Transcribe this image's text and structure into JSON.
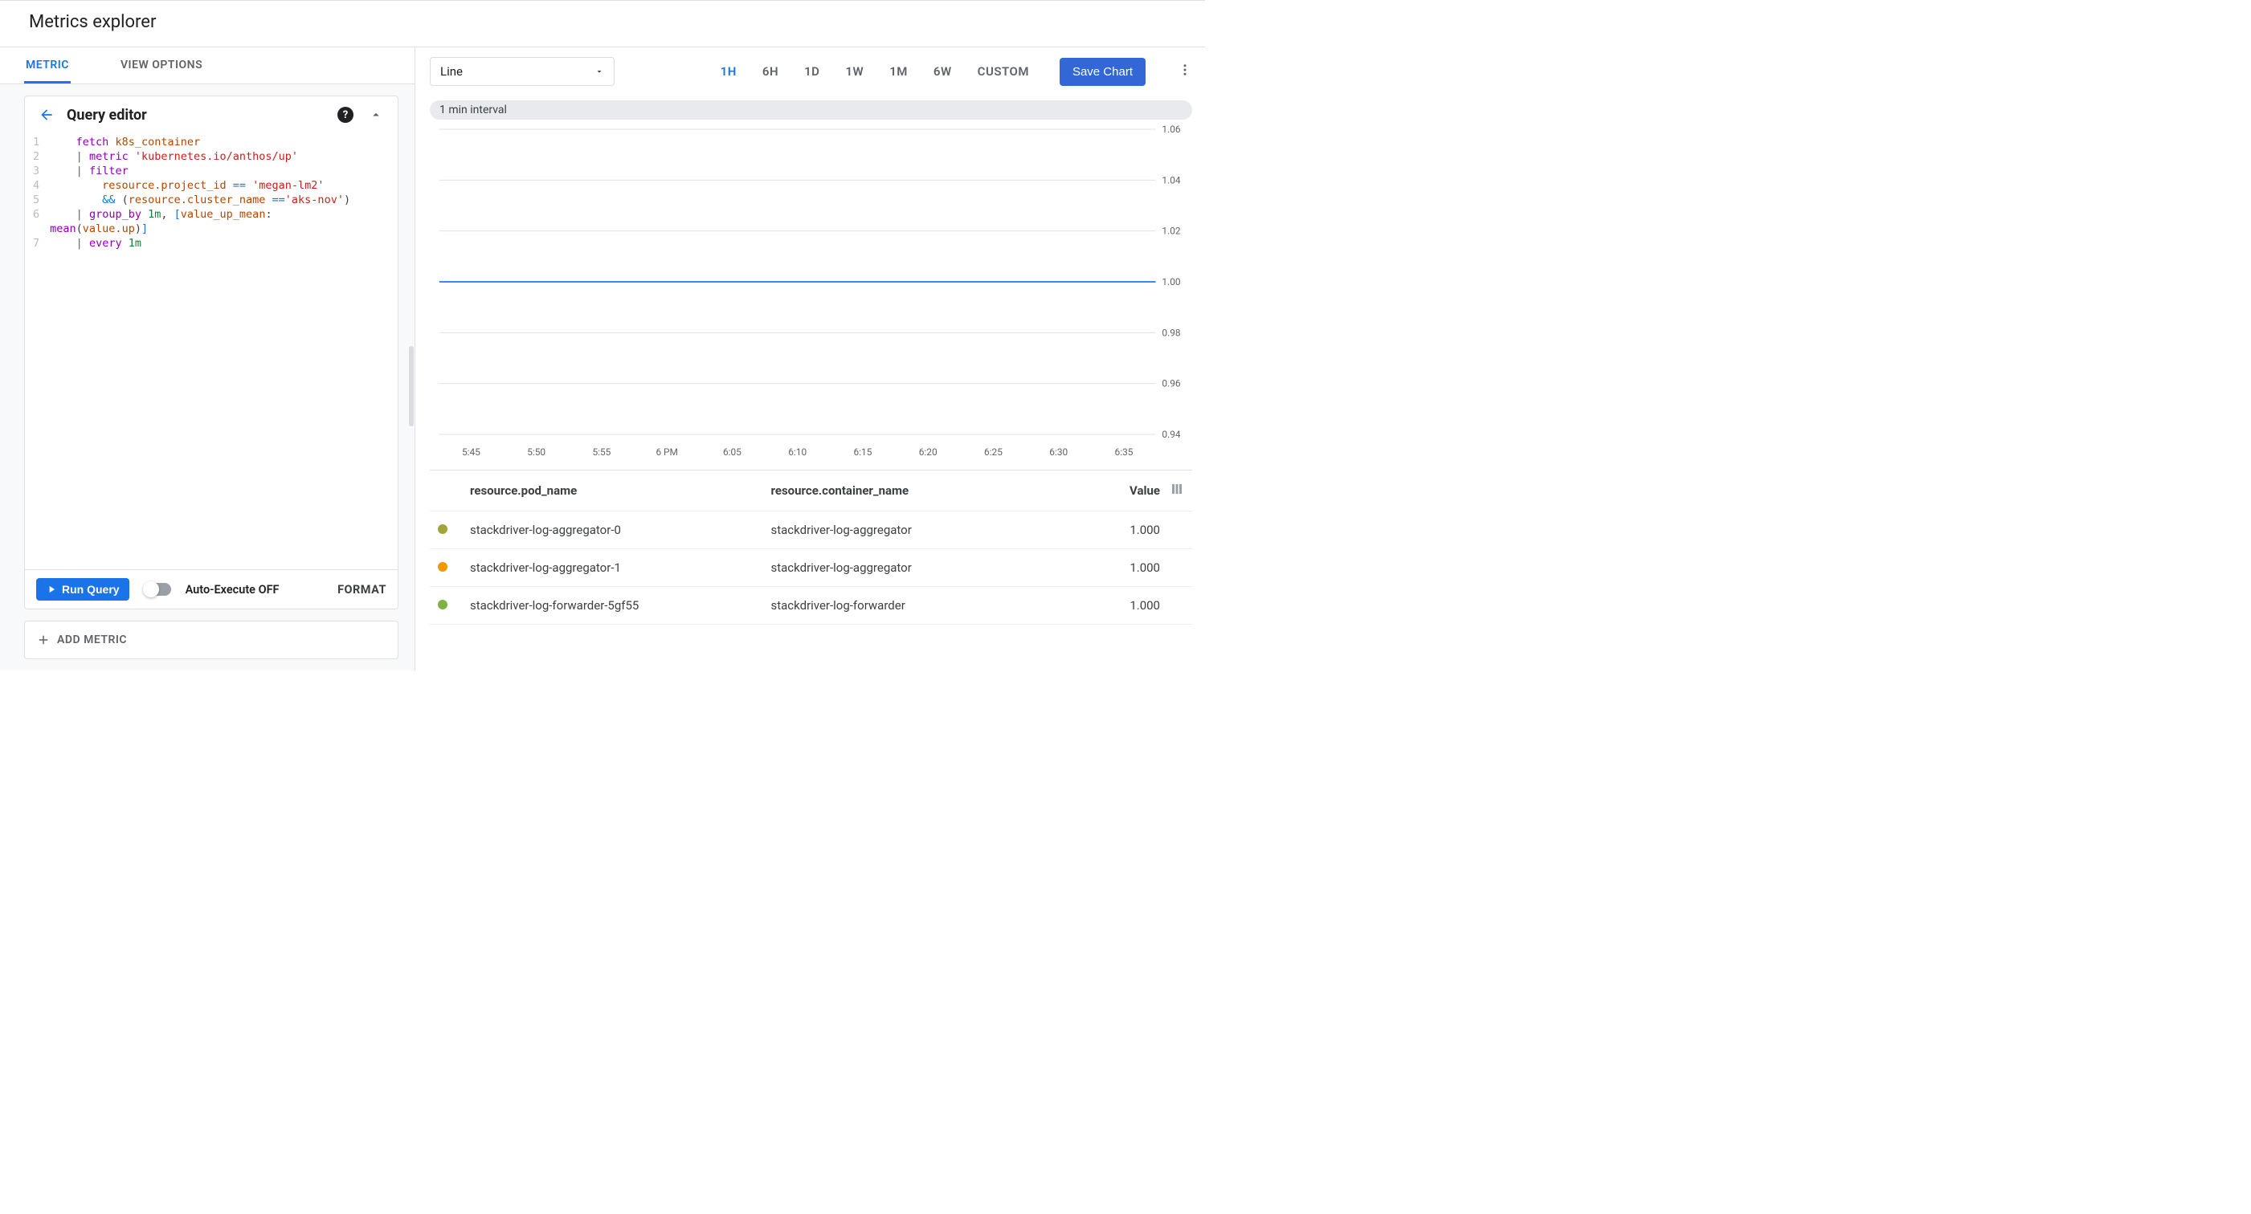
{
  "page_title": "Metrics explorer",
  "tabs": {
    "metric": "METRIC",
    "view_options": "VIEW OPTIONS",
    "active": "metric"
  },
  "query_editor": {
    "title": "Query editor",
    "lines": [
      {
        "n": 1,
        "html": "    <span class='kw-fetch'>fetch</span> <span class='kw-ident'>k8s_container</span>"
      },
      {
        "n": 2,
        "html": "    <span class='pipe'>|</span> <span class='kw-fetch'>metric</span> <span class='str'>'kubernetes.io/anthos/up'</span>"
      },
      {
        "n": 3,
        "html": "    <span class='pipe'>|</span> <span class='kw-fetch'>filter</span>"
      },
      {
        "n": 4,
        "html": "        <span class='fld'>resource.project_id</span> <span class='op'>==</span> <span class='str'>'megan-lm2'</span>"
      },
      {
        "n": 5,
        "html": "        <span class='op'>&amp;&amp;</span> (<span class='fld'>resource.cluster_name</span> <span class='op'>==</span><span class='str'>'aks-nov'</span>)"
      },
      {
        "n": 6,
        "html": "    <span class='pipe'>|</span> <span class='kw-fetch'>group_by</span> <span class='num'>1m</span>, <span class='brk'>[</span><span class='fld'>value_up_mean</span>:\n<span class='kw-fetch'>mean</span>(<span class='fld'>value.up</span>)<span class='brk'>]</span>"
      },
      {
        "n": 7,
        "html": "    <span class='pipe'>|</span> <span class='kw-fetch'>every</span> <span class='num'>1m</span>"
      }
    ],
    "run_label": "Run Query",
    "auto_exec_label": "Auto-Execute OFF",
    "format_label": "FORMAT",
    "add_metric_label": "ADD METRIC"
  },
  "chart_type_select": {
    "value": "Line"
  },
  "time_ranges": [
    "1H",
    "6H",
    "1D",
    "1W",
    "1M",
    "6W",
    "CUSTOM"
  ],
  "time_range_active": "1H",
  "save_chart_label": "Save Chart",
  "interval_label": "1 min interval",
  "chart_data": {
    "type": "line",
    "x_ticks": [
      "5:45",
      "5:50",
      "5:55",
      "6 PM",
      "6:05",
      "6:10",
      "6:15",
      "6:20",
      "6:25",
      "6:30",
      "6:35"
    ],
    "y_ticks": [
      0.94,
      0.96,
      0.98,
      1.0,
      1.02,
      1.04,
      1.06
    ],
    "ylim": [
      0.94,
      1.06
    ],
    "series": [
      {
        "name": "stackdriver-log-aggregator-0",
        "color": "#a1a43a",
        "constant_value": 1.0
      },
      {
        "name": "stackdriver-log-aggregator-1",
        "color": "#f29900",
        "constant_value": 1.0
      },
      {
        "name": "stackdriver-log-forwarder-5gf55",
        "color": "#7cb342",
        "constant_value": 1.0
      }
    ],
    "title": "",
    "xlabel": "",
    "ylabel": ""
  },
  "table": {
    "headers": {
      "pod": "resource.pod_name",
      "container": "resource.container_name",
      "value": "Value"
    },
    "rows": [
      {
        "color": "#a1a43a",
        "pod": "stackdriver-log-aggregator-0",
        "container": "stackdriver-log-aggregator",
        "value": "1.000"
      },
      {
        "color": "#f29900",
        "pod": "stackdriver-log-aggregator-1",
        "container": "stackdriver-log-aggregator",
        "value": "1.000"
      },
      {
        "color": "#7cb342",
        "pod": "stackdriver-log-forwarder-5gf55",
        "container": "stackdriver-log-forwarder",
        "value": "1.000"
      }
    ]
  }
}
